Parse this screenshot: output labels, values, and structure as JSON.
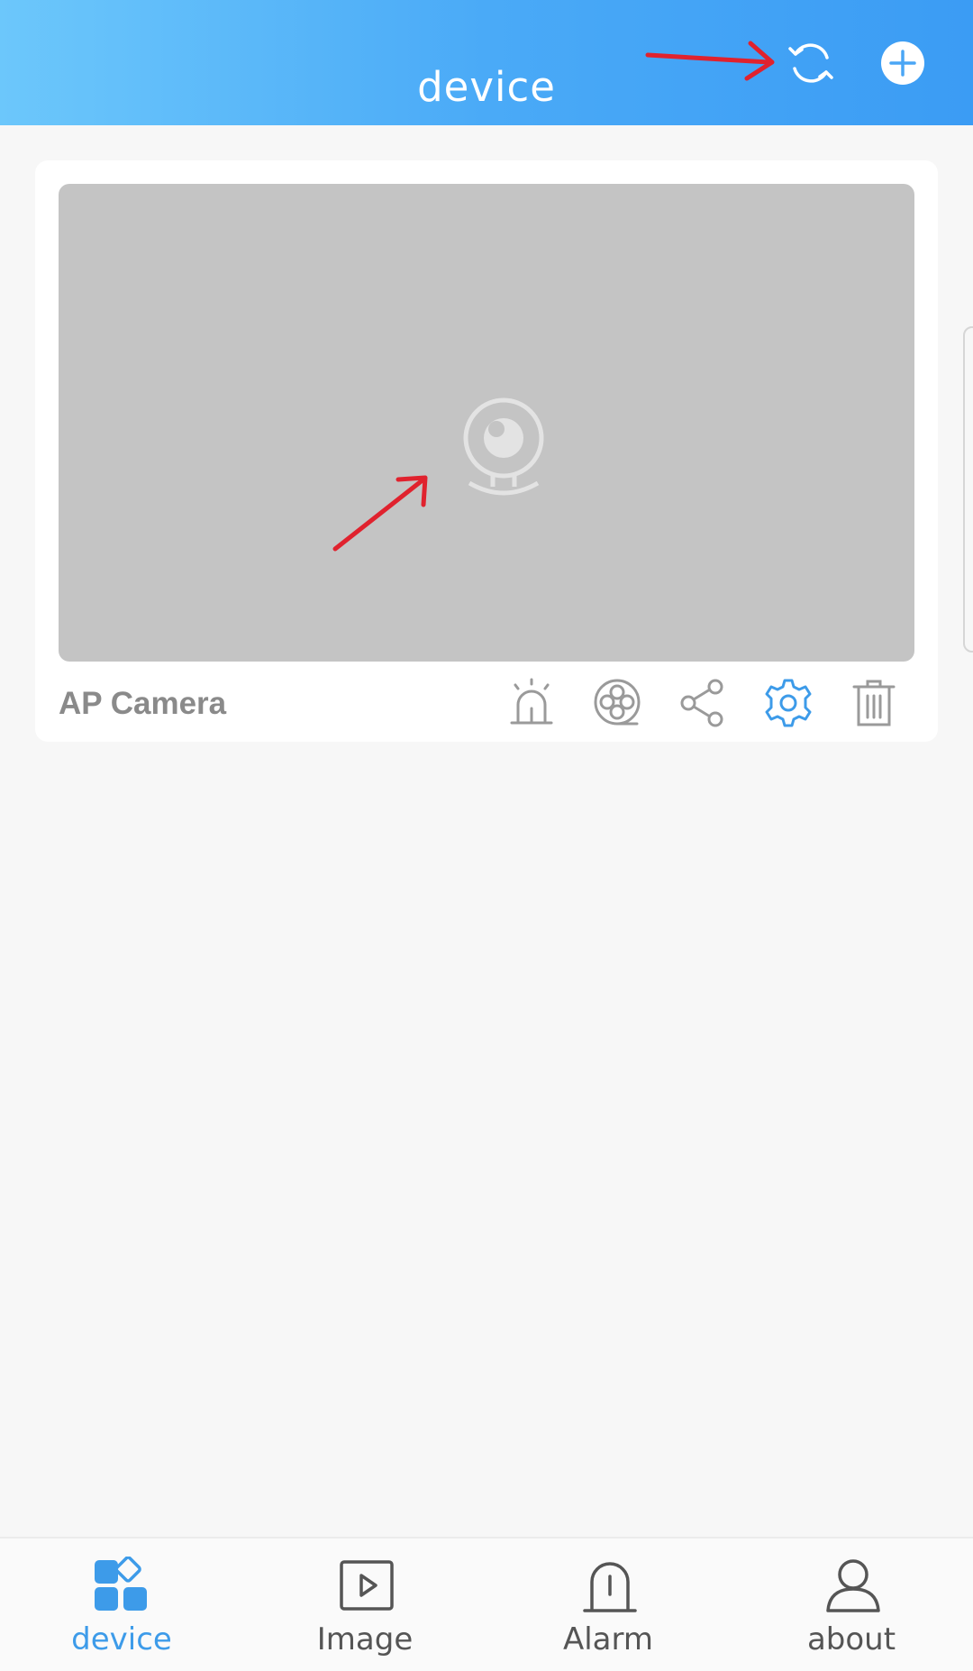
{
  "header": {
    "title": "device",
    "refresh_icon": "refresh-icon",
    "add_icon": "add-circle-icon"
  },
  "devices": [
    {
      "name": "AP Camera",
      "preview_icon": "camera-placeholder-icon",
      "actions": [
        {
          "name": "alarm-icon"
        },
        {
          "name": "video-reel-icon"
        },
        {
          "name": "share-icon"
        },
        {
          "name": "settings-gear-icon"
        },
        {
          "name": "trash-icon"
        }
      ]
    }
  ],
  "nav": {
    "items": [
      {
        "label": "device",
        "icon": "device-grid-icon",
        "active": true
      },
      {
        "label": "Image",
        "icon": "play-image-icon",
        "active": false
      },
      {
        "label": "Alarm",
        "icon": "alarm-bell-icon",
        "active": false
      },
      {
        "label": "about",
        "icon": "user-profile-icon",
        "active": false
      }
    ]
  },
  "colors": {
    "header_gradient_start": "#6cc7fb",
    "header_gradient_end": "#3b9cf4",
    "accent": "#3d9be9",
    "annotation_arrow": "#e0222e",
    "preview_bg": "#c4c4c4"
  }
}
